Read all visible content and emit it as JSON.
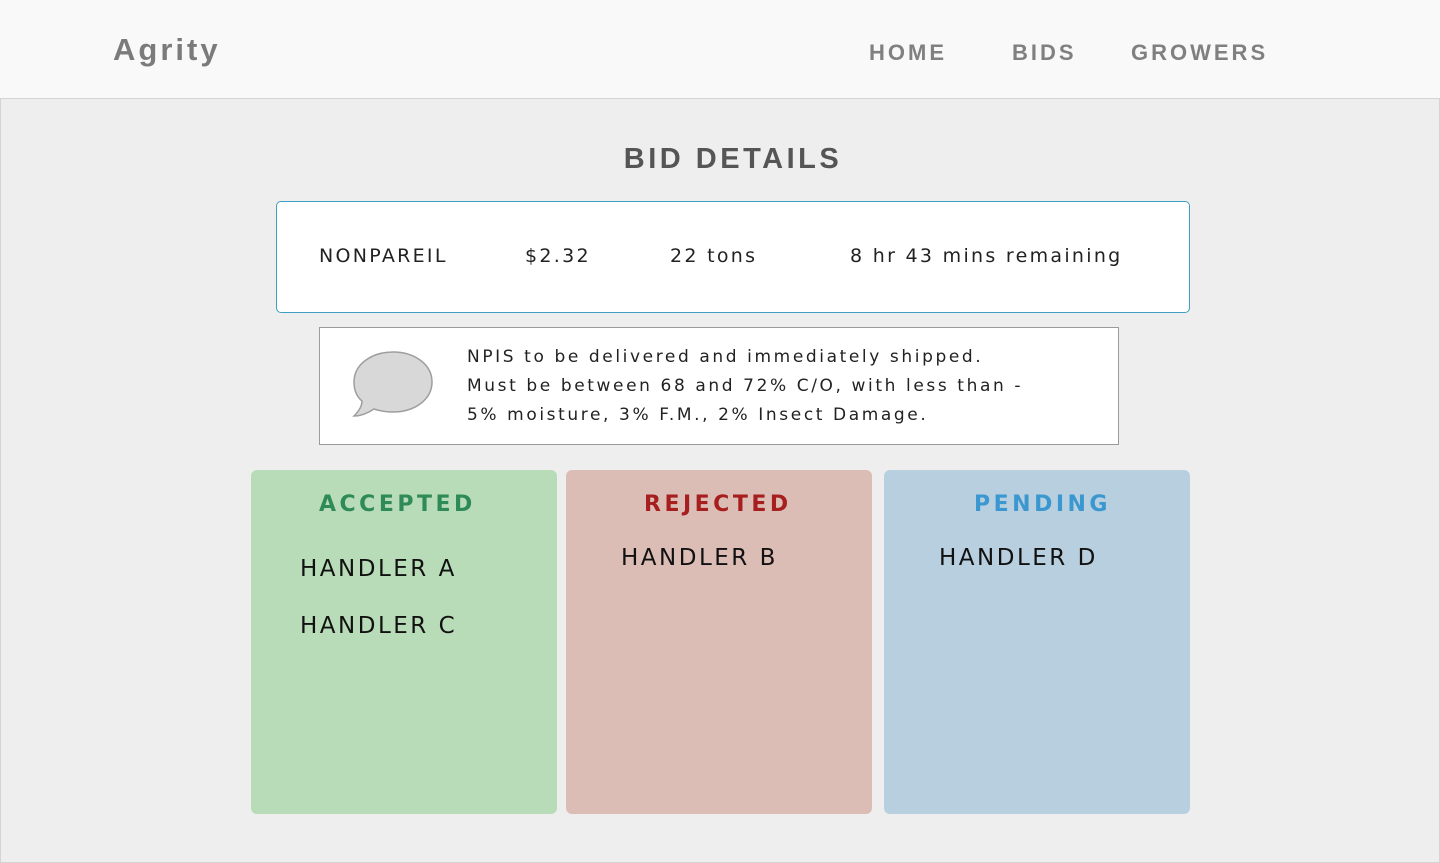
{
  "header": {
    "logo": "Agrity",
    "nav": [
      {
        "label": "HOME"
      },
      {
        "label": "BIDS"
      },
      {
        "label": "GROWERS"
      }
    ]
  },
  "page": {
    "title": "BID DETAILS"
  },
  "bid": {
    "variety": "NONPAREIL",
    "price": "$2.32",
    "quantity": "22 tons",
    "time_remaining": "8 hr 43 mins remaining"
  },
  "note": {
    "icon": "speech-bubble-icon",
    "lines": [
      "NPIS to be delivered and immediately shipped.",
      "Must be between 68 and 72% C/O, with less than -",
      "5% moisture, 3% F.M., 2% Insect Damage."
    ]
  },
  "columns": {
    "accepted": {
      "title": "ACCEPTED",
      "color": "#2e8b57",
      "handlers": [
        "HANDLER A",
        "HANDLER C"
      ]
    },
    "rejected": {
      "title": "REJECTED",
      "color": "#a61e1e",
      "handlers": [
        "HANDLER B"
      ]
    },
    "pending": {
      "title": "PENDING",
      "color": "#3a97cf",
      "handlers": [
        "HANDLER D"
      ]
    }
  }
}
